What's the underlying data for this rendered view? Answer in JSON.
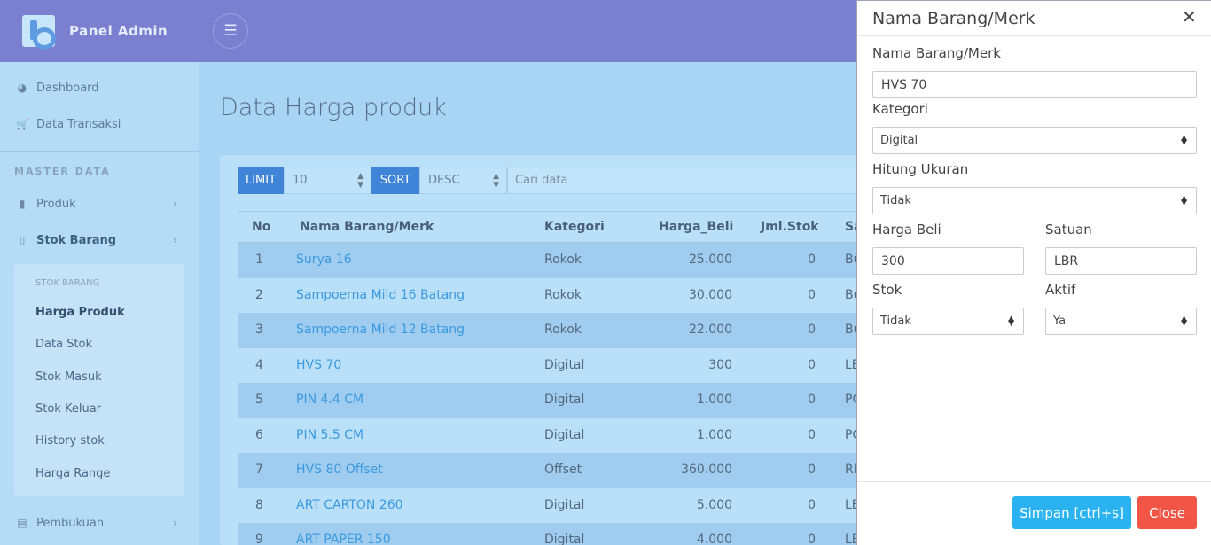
{
  "app": {
    "brand": "Panel Admin",
    "menu_icon": "hamburger-icon"
  },
  "sidebar": {
    "items": [
      {
        "label": "Dashboard",
        "icon": "dashboard-icon"
      },
      {
        "label": "Data Transaksi",
        "icon": "cart-icon"
      }
    ],
    "section": "MASTER DATA",
    "master": [
      {
        "label": "Produk",
        "icon": "file-icon"
      },
      {
        "label": "Stok Barang",
        "icon": "book-icon"
      }
    ],
    "submenu": {
      "header": "STOK BARANG",
      "items": [
        "Harga Produk",
        "Data Stok",
        "Stok Masuk",
        "Stok Keluar",
        "History stok",
        "Harga Range"
      ]
    },
    "pembukuan": {
      "label": "Pembukuan",
      "icon": "ledger-icon"
    }
  },
  "page": {
    "title": "Data Harga produk"
  },
  "toolbar": {
    "limit_label": "LIMIT",
    "limit_value": "10",
    "sort_label": "SORT",
    "sort_value": "DESC",
    "search_placeholder": "Cari data"
  },
  "table": {
    "headers": [
      "No",
      "Nama Barang/Merk",
      "Kategori",
      "Harga_Beli",
      "Jml.Stok",
      "Sa"
    ],
    "rows": [
      {
        "no": "1",
        "name": "Surya 16",
        "kategori": "Rokok",
        "harga": "25.000",
        "stok": "0",
        "sat": "Bu"
      },
      {
        "no": "2",
        "name": "Sampoerna Mild 16 Batang",
        "kategori": "Rokok",
        "harga": "30.000",
        "stok": "0",
        "sat": "Bu"
      },
      {
        "no": "3",
        "name": "Sampoerna Mild 12 Batang",
        "kategori": "Rokok",
        "harga": "22.000",
        "stok": "0",
        "sat": "Bu"
      },
      {
        "no": "4",
        "name": "HVS 70",
        "kategori": "Digital",
        "harga": "300",
        "stok": "0",
        "sat": "LE"
      },
      {
        "no": "5",
        "name": "PIN 4.4 CM",
        "kategori": "Digital",
        "harga": "1.000",
        "stok": "0",
        "sat": "PC"
      },
      {
        "no": "6",
        "name": "PIN 5.5 CM",
        "kategori": "Digital",
        "harga": "1.000",
        "stok": "0",
        "sat": "PC"
      },
      {
        "no": "7",
        "name": "HVS 80 Offset",
        "kategori": "Offset",
        "harga": "360.000",
        "stok": "0",
        "sat": "RI"
      },
      {
        "no": "8",
        "name": "ART CARTON 260",
        "kategori": "Digital",
        "harga": "5.000",
        "stok": "0",
        "sat": "LE"
      },
      {
        "no": "9",
        "name": "ART PAPER 150",
        "kategori": "Digital",
        "harga": "4.000",
        "stok": "0",
        "sat": "LE"
      }
    ]
  },
  "modal": {
    "title": "Nama Barang/Merk",
    "name_label": "Nama Barang/Merk",
    "name_value": "HVS 70",
    "kategori_label": "Kategori",
    "kategori_value": "Digital",
    "hitung_label": "Hitung Ukuran",
    "hitung_value": "Tidak",
    "harga_label": "Harga Beli",
    "harga_value": "300",
    "satuan_label": "Satuan",
    "satuan_value": "LBR",
    "stok_label": "Stok",
    "stok_value": "Tidak",
    "aktif_label": "Aktif",
    "aktif_value": "Ya",
    "save_label": "Simpan [ctrl+s]",
    "close_label": "Close"
  },
  "colors": {
    "primary": "#3f84d6",
    "save": "#2ab3f0",
    "close": "#f05545",
    "topbar": "#7a7fd0"
  }
}
